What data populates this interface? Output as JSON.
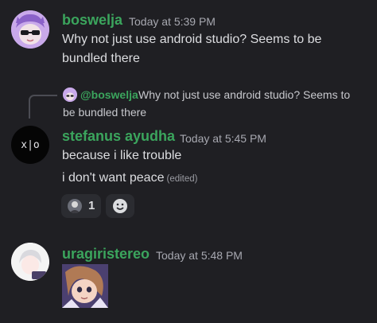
{
  "messages": [
    {
      "username": "boswelja",
      "timestamp": "Today at 5:39 PM",
      "lines": [
        "Why not just use android studio? Seems to be",
        "bundled there"
      ],
      "name_color": "#3ba55d"
    },
    {
      "reply": {
        "username": "@boswelja",
        "text_line1": "Why not just use android studio? Seems to",
        "text_line2": "be bundled there",
        "name_color": "#3ba55d"
      },
      "username": "stefanus ayudha",
      "timestamp": "Today at 5:45 PM",
      "lines": [
        "because i like trouble",
        "i don't want peace"
      ],
      "edited": "(edited)",
      "avatar_text": "x|o",
      "reactions": [
        {
          "icon": "profile-avatar-emoji",
          "count": "1"
        },
        {
          "icon": "add-reaction-smiley"
        }
      ],
      "name_color": "#3ba55d"
    },
    {
      "username": "uragiristereo",
      "timestamp": "Today at 5:48 PM",
      "attachment": "anime-character-image",
      "name_color": "#3ba55d"
    }
  ]
}
